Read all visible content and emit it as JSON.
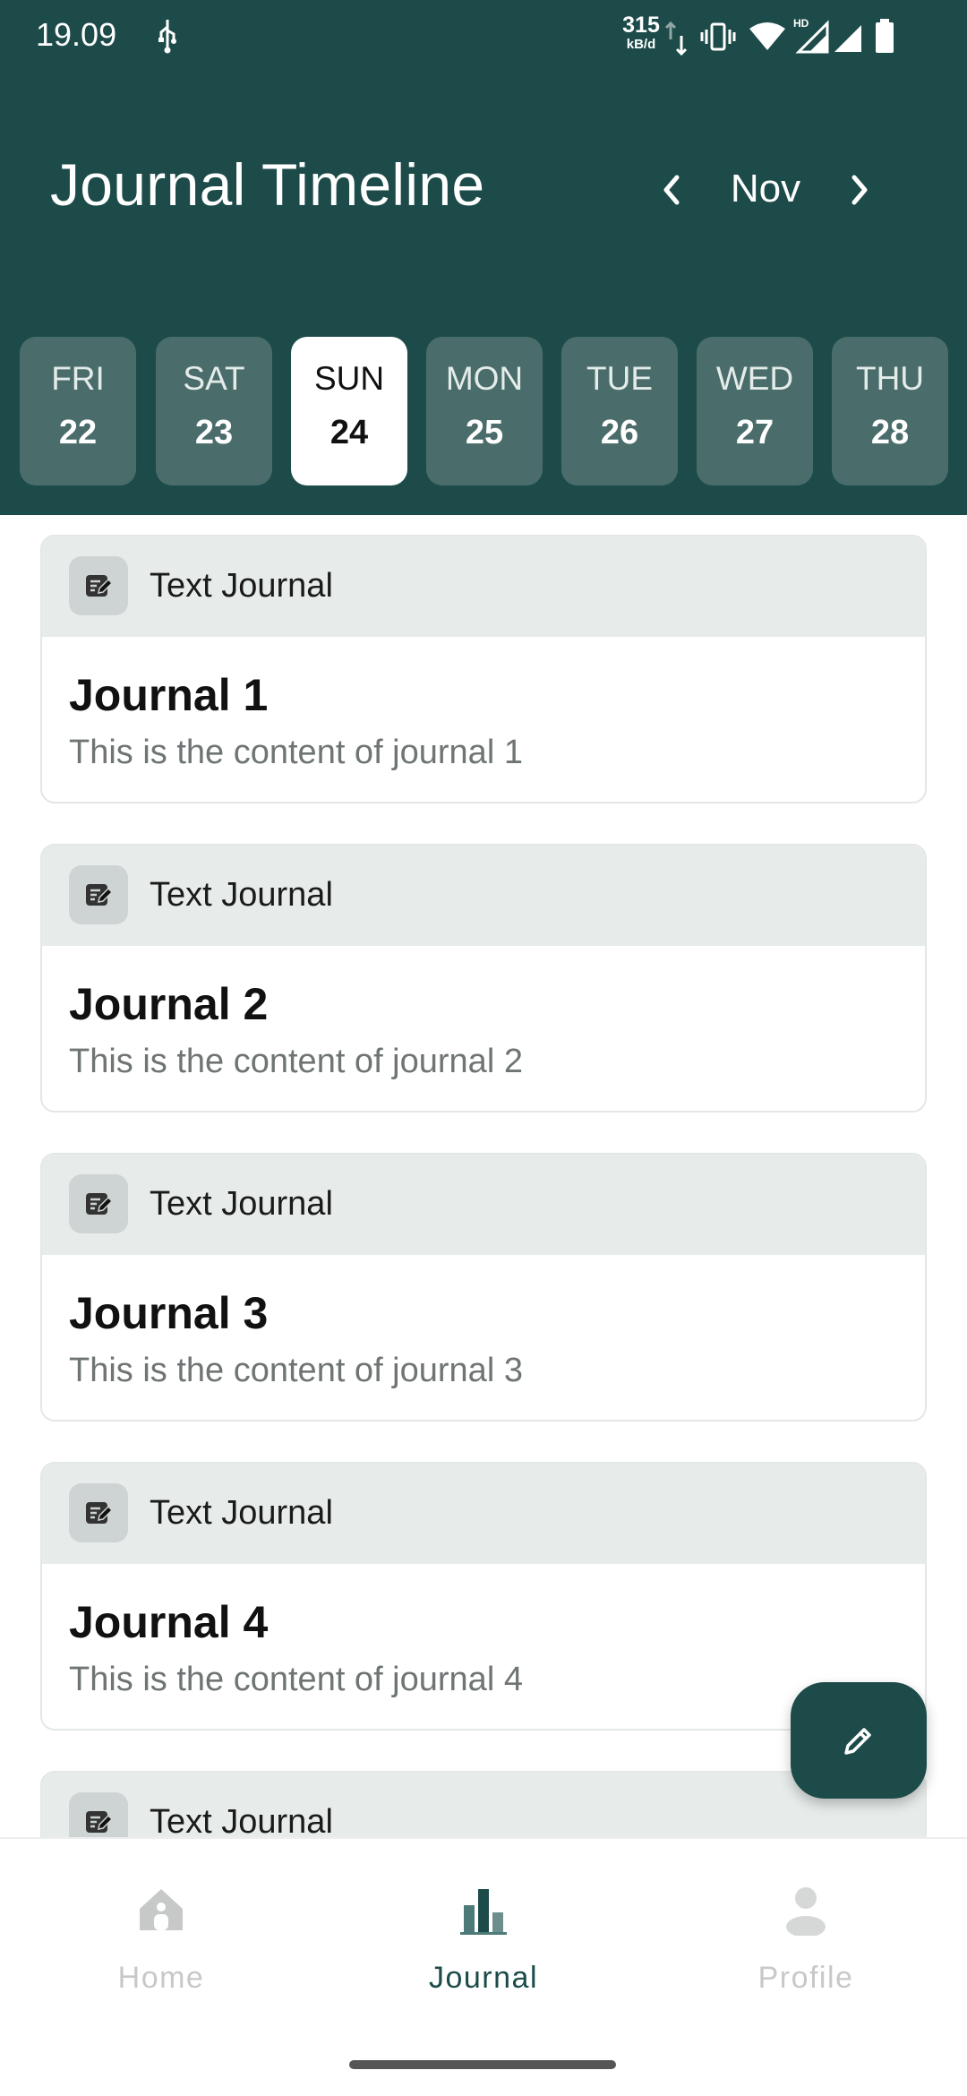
{
  "status_bar": {
    "time": "19.09",
    "net_speed_value": "315",
    "net_speed_unit": "kB/d",
    "icons": [
      "usb-icon",
      "data-transfer-icon",
      "vibrate-icon",
      "wifi-icon",
      "hd-signal-icon",
      "signal-icon",
      "battery-icon"
    ]
  },
  "header": {
    "title": "Journal Timeline",
    "month": "Nov",
    "prev_icon": "chevron-left-icon",
    "next_icon": "chevron-right-icon"
  },
  "days": [
    {
      "name": "FRI",
      "num": "22",
      "selected": false
    },
    {
      "name": "SAT",
      "num": "23",
      "selected": false
    },
    {
      "name": "SUN",
      "num": "24",
      "selected": true
    },
    {
      "name": "MON",
      "num": "25",
      "selected": false
    },
    {
      "name": "TUE",
      "num": "26",
      "selected": false
    },
    {
      "name": "WED",
      "num": "27",
      "selected": false
    },
    {
      "name": "THU",
      "num": "28",
      "selected": false
    }
  ],
  "journals": [
    {
      "type": "Text Journal",
      "title": "Journal 1",
      "content": "This is the content of journal 1"
    },
    {
      "type": "Text Journal",
      "title": "Journal 2",
      "content": "This is the content of journal 2"
    },
    {
      "type": "Text Journal",
      "title": "Journal 3",
      "content": "This is the content of journal 3"
    },
    {
      "type": "Text Journal",
      "title": "Journal 4",
      "content": "This is the content of journal 4"
    },
    {
      "type": "Text Journal",
      "title": "",
      "content": ""
    }
  ],
  "fab": {
    "icon": "pencil-icon"
  },
  "nav": {
    "items": [
      {
        "label": "Home",
        "icon": "home-icon",
        "active": false
      },
      {
        "label": "Journal",
        "icon": "bar-chart-icon",
        "active": true
      },
      {
        "label": "Profile",
        "icon": "person-icon",
        "active": false
      }
    ]
  },
  "colors": {
    "primary": "#1c4b49",
    "chip": "#4a6d6b",
    "card_header": "#e7eceb",
    "inactive_nav": "#c7c9c9"
  }
}
